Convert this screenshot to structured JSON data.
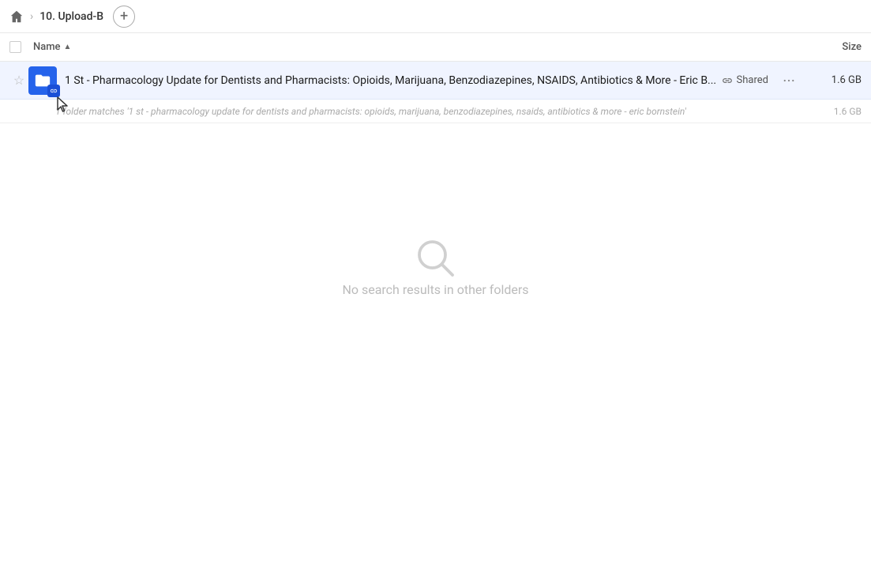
{
  "header": {
    "home_icon": "🏠",
    "breadcrumb_separator": "›",
    "breadcrumb_item": "10. Upload-B",
    "add_button_label": "+"
  },
  "columns": {
    "name_label": "Name",
    "sort_icon": "▲",
    "size_label": "Size"
  },
  "file_row": {
    "star_icon": "☆",
    "folder_name": "1 St - Pharmacology Update for Dentists and Pharmacists: Opioids, Marijuana, Benzodiazepines, NSAIDS, Antibiotics & More - Eric B...",
    "shared_label": "Shared",
    "more_icon": "···",
    "size": "1.6 GB"
  },
  "match_info": {
    "text": "1 folder matches '1 st - pharmacology update for dentists and pharmacists: opioids, marijuana, benzodiazepines, nsaids, antibiotics & more - eric bornstein'",
    "size": "1.6 GB"
  },
  "empty_state": {
    "message": "No search results in other folders"
  }
}
